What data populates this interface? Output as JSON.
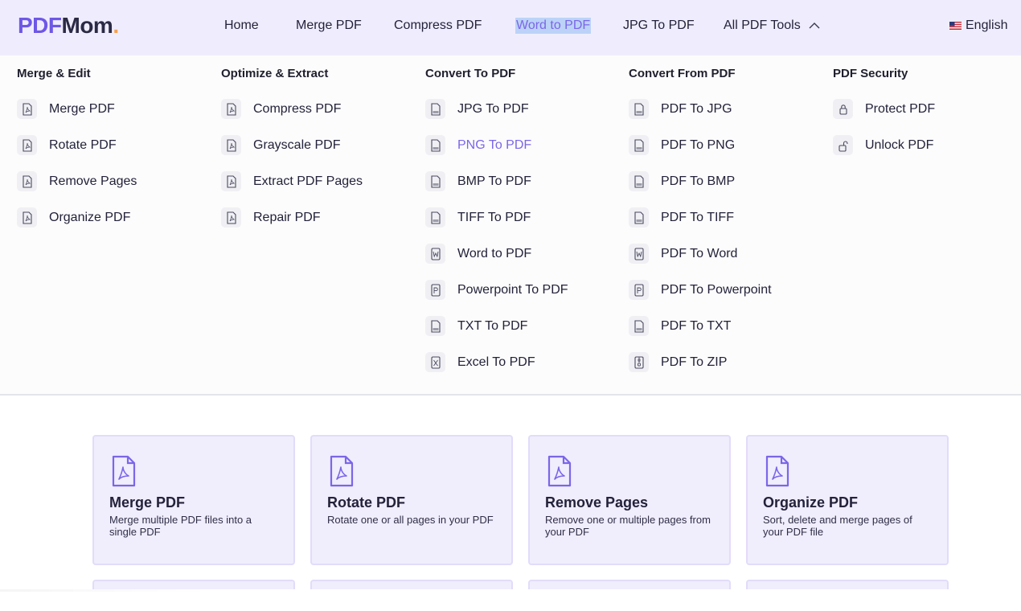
{
  "brand": {
    "part1": "PDF",
    "part2": "Mom",
    "part3": ".",
    "color_primary": "#6f57e6",
    "color_dot": "#f5a050"
  },
  "nav": {
    "items": [
      {
        "label": "Home"
      },
      {
        "label": "Merge PDF"
      },
      {
        "label": "Compress PDF"
      },
      {
        "label": "Word to PDF"
      },
      {
        "label": "JPG To PDF"
      },
      {
        "label": "All PDF Tools"
      }
    ],
    "language": "English"
  },
  "menu": {
    "columns": [
      {
        "title": "Merge & Edit",
        "items": [
          {
            "label": "Merge PDF",
            "icon": "pdf-file-icon"
          },
          {
            "label": "Rotate PDF",
            "icon": "pdf-file-icon"
          },
          {
            "label": "Remove Pages",
            "icon": "pdf-file-icon"
          },
          {
            "label": "Organize PDF",
            "icon": "pdf-file-icon"
          }
        ]
      },
      {
        "title": "Optimize & Extract",
        "items": [
          {
            "label": "Compress PDF",
            "icon": "pdf-file-icon"
          },
          {
            "label": "Grayscale PDF",
            "icon": "pdf-file-icon"
          },
          {
            "label": "Extract PDF Pages",
            "icon": "pdf-file-icon"
          },
          {
            "label": "Repair PDF",
            "icon": "pdf-file-icon"
          }
        ]
      },
      {
        "title": "Convert To PDF",
        "items": [
          {
            "label": "JPG To PDF",
            "icon": "jpg-file-icon"
          },
          {
            "label": "PNG To PDF",
            "icon": "png-file-icon"
          },
          {
            "label": "BMP To PDF",
            "icon": "bmp-file-icon"
          },
          {
            "label": "TIFF To PDF",
            "icon": "tiff-file-icon"
          },
          {
            "label": "Word to PDF",
            "icon": "word-file-icon"
          },
          {
            "label": "Powerpoint To PDF",
            "icon": "powerpoint-file-icon"
          },
          {
            "label": "TXT To PDF",
            "icon": "txt-file-icon"
          },
          {
            "label": "Excel To PDF",
            "icon": "excel-file-icon"
          }
        ]
      },
      {
        "title": "Convert From PDF",
        "items": [
          {
            "label": "PDF To JPG",
            "icon": "jpg-file-icon"
          },
          {
            "label": "PDF To PNG",
            "icon": "png-file-icon"
          },
          {
            "label": "PDF To BMP",
            "icon": "bmp-file-icon"
          },
          {
            "label": "PDF To TIFF",
            "icon": "tiff-file-icon"
          },
          {
            "label": "PDF To Word",
            "icon": "word-file-icon"
          },
          {
            "label": "PDF To Powerpoint",
            "icon": "powerpoint-file-icon"
          },
          {
            "label": "PDF To TXT",
            "icon": "txt-file-icon"
          },
          {
            "label": "PDF To ZIP",
            "icon": "zip-file-icon"
          }
        ]
      },
      {
        "title": "PDF Security",
        "items": [
          {
            "label": "Protect PDF",
            "icon": "lock-icon"
          },
          {
            "label": "Unlock PDF",
            "icon": "unlock-icon"
          }
        ]
      }
    ]
  },
  "cards": [
    {
      "title": "Merge PDF",
      "desc": "Merge multiple PDF files into a single PDF"
    },
    {
      "title": "Rotate PDF",
      "desc": "Rotate one or all pages in your PDF"
    },
    {
      "title": "Remove Pages",
      "desc": "Remove one or multiple pages from your PDF"
    },
    {
      "title": "Organize PDF",
      "desc": "Sort, delete and merge pages of your PDF file"
    }
  ]
}
